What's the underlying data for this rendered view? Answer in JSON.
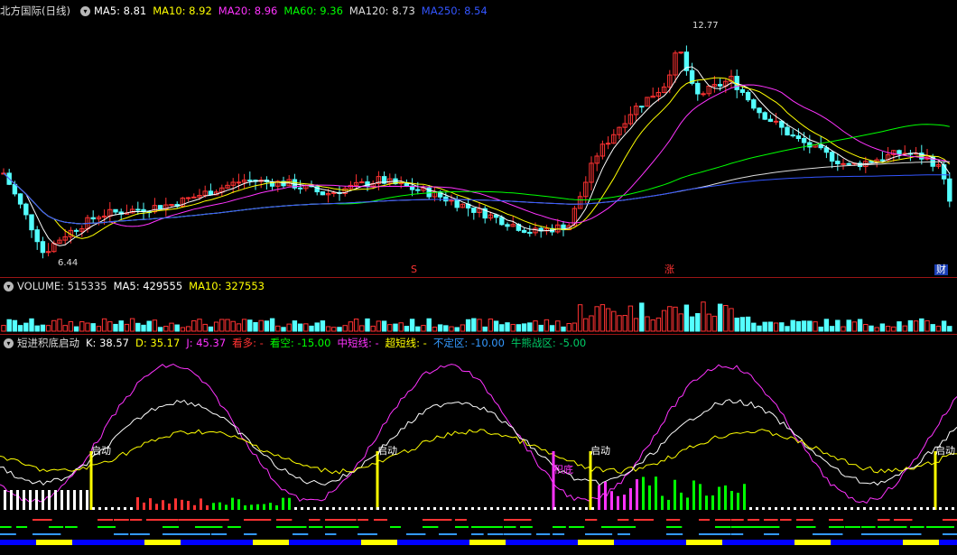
{
  "main_panel": {
    "title": "北方国际(日线)",
    "ma_values": [
      {
        "label": "MA5: 8.81",
        "color": "#ffffff"
      },
      {
        "label": "MA10: 8.92",
        "color": "#ffff00"
      },
      {
        "label": "MA20: 8.96",
        "color": "#ff33ff"
      },
      {
        "label": "MA60: 9.36",
        "color": "#00ff00"
      },
      {
        "label": "MA120: 8.73",
        "color": "#dddddd"
      },
      {
        "label": "MA250: 8.54",
        "color": "#3355ff"
      }
    ],
    "high_label": "12.77",
    "low_label": "6.44",
    "markers": {
      "s": "S",
      "zhang": "涨",
      "cai": "财"
    }
  },
  "volume_panel": {
    "title": "VOLUME: 515335",
    "ma5": "MA5: 429555",
    "ma10": "MA10: 327553"
  },
  "indicator_panel": {
    "title": "短进积底启动",
    "k": "K: 38.57",
    "d": "D: 35.17",
    "j": "J: 45.37",
    "kanduo": "看多: -",
    "kankong": "看空: -15.00",
    "zhongduan": "中短线: -",
    "chaoduan": "超短线: -",
    "buding": "不定区: -10.00",
    "niuxiong": "牛熊战区: -5.00",
    "signals": {
      "qidong": "启动",
      "jidi": "积底"
    }
  },
  "colors": {
    "up": "#ff3232",
    "down": "#54ffff",
    "divider": "#9a1515",
    "k_line": "#ffffff",
    "d_line": "#ffff00",
    "j_line": "#ff33ff"
  }
}
